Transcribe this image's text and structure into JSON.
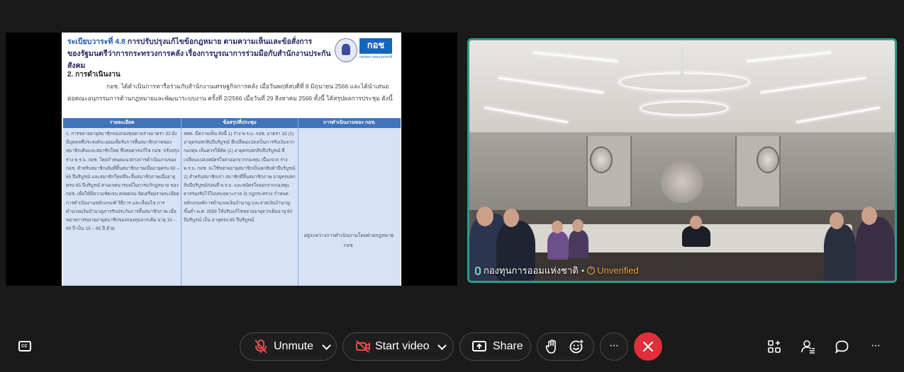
{
  "shared_content": {
    "agenda_label": "ระเบียบวาระที่ 4.8",
    "title_line1": "การปรับปรุงแก้ไขข้อกฎหมาย ตามความเห็นและข้อสั่งการ",
    "title_line2": "ของรัฐมนตรีว่าการกระทรวงการคลัง เรื่องการบูรณาการร่วมมือกับสำนักงานประกันสังคม",
    "logo_text": "กอช",
    "logo_subtext": "กองทุนการออมแห่งชาติ",
    "section_heading": "2. การดำเนินงาน",
    "paragraph": "กอช. ได้ดำเนินการหารือร่วมกับสำนักงานเศรษฐกิจการคลัง เมื่อวันพฤหัสบดีที่ 8 มิถุนายน 2566 และได้นำเสนอต่อคณะอนุกรรมการด้านกฎหมายและพัฒนาระบบงาน ครั้งที่ 2/2566 เมื่อวันที่ 29 สิงหาคม 2566 ทั้งนี้ ได้สรุปผลการประชุม ดังนี้",
    "table": {
      "headers": [
        "รายละเอียด",
        "ข้อสรุปที่ประชุม",
        "การดำเนินงานของ กอช."
      ],
      "col1_text": "1. การขยายอายุสมาชิกของกองทุนตามร่างมาตรา 32 ยังมีบุคคลที่ประสงค์จะออมเพื่อรับการสิ้นสมาชิกภาพของสมาชิกเดิมและสมาชิกใหม่ ซึ่งสมควรแก้ไข กอช. ปรับปรุงร่าง พ.ร.บ. กอช. โดยกำหนดแนวทางการดำเนินงานของ กอช. สำหรับสมาชิกเดิมที่สิ้นสมาชิกภาพเมื่ออายุครบ 60 – 65 ปีบริบูรณ์ และสมาชิกใหม่ที่จะสิ้นสมาชิกภาพเมื่ออายุครบ 65 ปีบริบูรณ์ ตามเจตนารมณ์ในการแก้กฎหมาย ของ กอช. เพื่อให้มีความชัดเจน ตลอดจน จัดเตรียมรายละเอียดการดำเนินงานหลักเกณฑ์ วิธีการ และเงื่อนไข การคำนวณเงินบำนาญการรับประกันการสิ้นสมาชิกภาพ เมื่อขยายการขยายอายุสมาชิกของกองทุนจากเดิม อายุ 15 – 60 ปี เป็น 15 – 65 ปี ด้วย",
      "col2_text": "สศค. มีความเห็น ดังนี้ 1) ร่าง พ.ร.บ. กอช. มาตรา 33 (1) อายุครบหกสิบปีบริบูรณ์ ที่เปลี่ยนแปลงเป็นการรับเงินจากกองทุน เห็นควรให้ตัด (1) อายุครบหกสิบปีบริบูรณ์ ที่เปลี่ยนแปลงสมัครใจลาออกจากกองทุน เนื่องจาก ร่าง พ.ร.บ. กอช. จะใช้ขยายอายุสมาชิกเป็นหกสิบห้าปีบริบูรณ์ 2) สำหรับสมาชิกเก่า สมาชิกที่สิ้นสมาชิกภาพ อายุครบหกสิบปีบริบูรณ์ก่อนที่ พ.ร.บ. และสมัครใจออกจากกองทุน ควรรองรับไว้ในบทเฉพาะกาล 3) กฎกระทรวง กำหนดหลักเกณฑ์การคำนวณเงินบำนาญ และจ่ายเงินบำนาญขั้นต่ำ พ.ศ. 2558 ให้ปรับแก้ไขขยายอายุจากเดิมอายุ 60 ปีบริบูรณ์ เป็น อายุครบ 65 ปีบริบูรณ์",
      "col3_text": "อยู่ระหว่างการดำเนินงานโดยฝ่ายกฎหมาย กอช."
    }
  },
  "video_tile": {
    "participant_name": "กองทุนการออมแห่งชาติ",
    "separator": "•",
    "verification_status": "Unverified",
    "status_icon": "question-icon",
    "border_color": "#2e9b8b"
  },
  "controls": {
    "captions_icon": "captions-icon",
    "unmute_label": "Unmute",
    "start_video_label": "Start video",
    "share_label": "Share",
    "raise_hand_icon": "hand-icon",
    "reactions_icon": "emoji-icon",
    "more_icon": "more-icon",
    "end_icon": "close-icon",
    "end_color": "#e02f38",
    "apps_icon": "apps-icon",
    "participants_icon": "participants-icon",
    "chat_icon": "chat-icon",
    "more_right_icon": "more-icon"
  }
}
